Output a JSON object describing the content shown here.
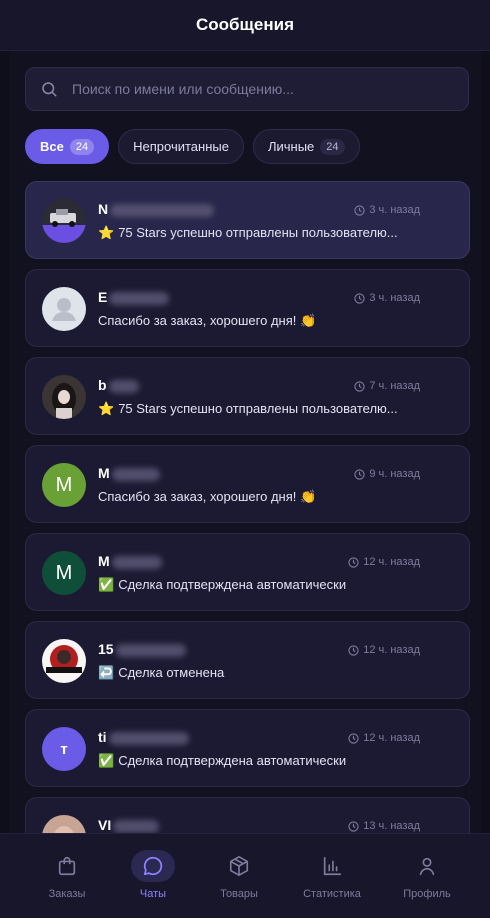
{
  "header": {
    "title": "Сообщения"
  },
  "search": {
    "placeholder": "Поиск по имени или сообщению..."
  },
  "filters": [
    {
      "label": "Все",
      "count": "24",
      "active": true
    },
    {
      "label": "Непрочитанные",
      "count": null,
      "active": false
    },
    {
      "label": "Личные",
      "count": "24",
      "active": false
    }
  ],
  "chats": [
    {
      "name": "N",
      "time": "3 ч. назад",
      "preview": "75 Stars успешно отправлены пользователю...",
      "preview_icon": "star-emoji-icon",
      "avatar_type": "photo",
      "avatar_icon": "photo-avatar-icon"
    },
    {
      "name": "E",
      "time": "3 ч. назад",
      "preview": "Спасибо за заказ, хорошего дня! 👏",
      "preview_icon": null,
      "avatar_type": "default",
      "avatar_icon": "default-user-avatar-icon"
    },
    {
      "name": "b",
      "time": "7 ч. назад",
      "preview": "75 Stars успешно отправлены пользователю...",
      "preview_icon": "star-emoji-icon",
      "avatar_type": "photo",
      "avatar_icon": "photo-avatar-icon"
    },
    {
      "name": "M",
      "time": "9 ч. назад",
      "preview": "Спасибо за заказ, хорошего дня! 👏",
      "preview_icon": null,
      "avatar_type": "letter",
      "avatar_letter": "M",
      "avatar_color": "#6aa136"
    },
    {
      "name": "M",
      "time": "12 ч. назад",
      "preview": "Сделка подтверждена автоматически",
      "preview_icon": "check-box-icon",
      "avatar_type": "letter",
      "avatar_letter": "M",
      "avatar_color": "#0f4f3a"
    },
    {
      "name": "15",
      "time": "12 ч. назад",
      "preview": "Сделка отменена",
      "preview_icon": "return-arrow-icon",
      "avatar_type": "photo",
      "avatar_icon": "game-logo-avatar-icon"
    },
    {
      "name": "ti",
      "time": "12 ч. назад",
      "preview": "Сделка подтверждена автоматически",
      "preview_icon": "check-box-icon",
      "avatar_type": "letter",
      "avatar_letter": "т",
      "avatar_color": "#6b5ce8"
    },
    {
      "name": "VI",
      "time": "13 ч. назад",
      "preview": "",
      "preview_icon": null,
      "avatar_type": "photo",
      "avatar_icon": "photo-avatar-icon"
    }
  ],
  "tabs": [
    {
      "label": "Заказы",
      "icon": "shopping-bag-icon",
      "active": false
    },
    {
      "label": "Чаты",
      "icon": "chat-bubble-icon",
      "active": true
    },
    {
      "label": "Товары",
      "icon": "box-icon",
      "active": false
    },
    {
      "label": "Статистика",
      "icon": "bar-chart-icon",
      "active": false
    },
    {
      "label": "Профиль",
      "icon": "user-icon",
      "active": false
    }
  ],
  "colors": {
    "accent": "#6b5ce8",
    "active_tab": "#8f82ff",
    "background": "#0f0e1a",
    "card": "#1c1a33"
  }
}
